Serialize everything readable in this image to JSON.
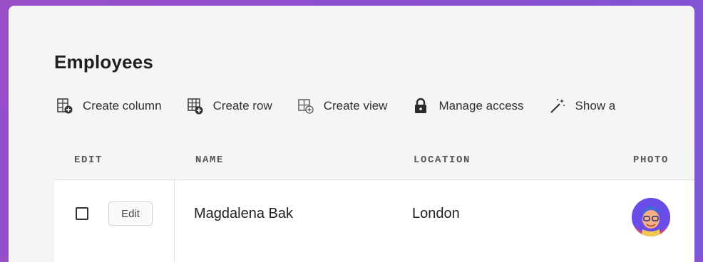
{
  "page": {
    "title": "Employees"
  },
  "toolbar": {
    "items": [
      {
        "label": "Create column",
        "icon": "add-column-icon"
      },
      {
        "label": "Create row",
        "icon": "add-row-icon"
      },
      {
        "label": "Create view",
        "icon": "add-view-icon"
      },
      {
        "label": "Manage access",
        "icon": "lock-icon"
      },
      {
        "label": "Show a",
        "icon": "magic-wand-icon"
      }
    ]
  },
  "table": {
    "columns": [
      "EDIT",
      "NAME",
      "LOCATION",
      "PHOTO"
    ],
    "rows": [
      {
        "edit_label": "Edit",
        "name": "Magdalena Bak",
        "location": "London",
        "photo": "avatar"
      }
    ]
  },
  "colors": {
    "background_gradient_start": "#9b4fc9",
    "background_gradient_end": "#7a5ad8",
    "panel": "#f5f5f6",
    "row": "#ffffff"
  }
}
